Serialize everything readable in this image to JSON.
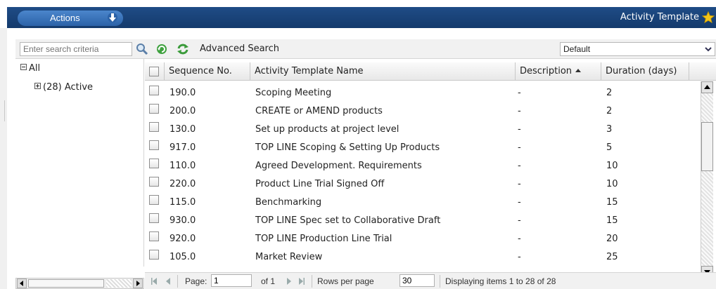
{
  "header": {
    "actions_label": "Actions",
    "title": "Activity Template"
  },
  "toolbar": {
    "search_placeholder": "Enter search criteria",
    "advanced_search": "Advanced Search",
    "view_selected": "Default"
  },
  "tree": {
    "root": "All",
    "child": "(28) Active"
  },
  "grid": {
    "columns": {
      "sequence": "Sequence No.",
      "name": "Activity Template Name",
      "description": "Description",
      "duration": "Duration (days)"
    },
    "rows": [
      {
        "seq": "190.0",
        "name": "Scoping Meeting",
        "desc": "-",
        "dur": "2"
      },
      {
        "seq": "200.0",
        "name": "CREATE or AMEND products",
        "desc": "-",
        "dur": "2"
      },
      {
        "seq": "130.0",
        "name": "Set up products at project level",
        "desc": "-",
        "dur": "3"
      },
      {
        "seq": "917.0",
        "name": "TOP LINE Scoping & Setting Up Products",
        "desc": "-",
        "dur": "5"
      },
      {
        "seq": "110.0",
        "name": "Agreed Development. Requirements",
        "desc": "-",
        "dur": "10"
      },
      {
        "seq": "220.0",
        "name": "Product Line Trial Signed Off",
        "desc": "-",
        "dur": "10"
      },
      {
        "seq": "115.0",
        "name": "Benchmarking",
        "desc": "-",
        "dur": "15"
      },
      {
        "seq": "930.0",
        "name": "TOP LINE Spec set to Collaborative Draft",
        "desc": "-",
        "dur": "15"
      },
      {
        "seq": "920.0",
        "name": "TOP LINE Production Line Trial",
        "desc": "-",
        "dur": "20"
      },
      {
        "seq": "105.0",
        "name": "Market Review",
        "desc": "-",
        "dur": "25"
      }
    ]
  },
  "pager": {
    "page_label": "Page:",
    "page_value": "1",
    "of_label": "of 1",
    "rows_label": "Rows per page",
    "rows_value": "30",
    "displaying": "Displaying items 1 to 28 of 28"
  },
  "colors": {
    "header_bg": "#1f4c86",
    "button_bg": "#3a73bb"
  }
}
